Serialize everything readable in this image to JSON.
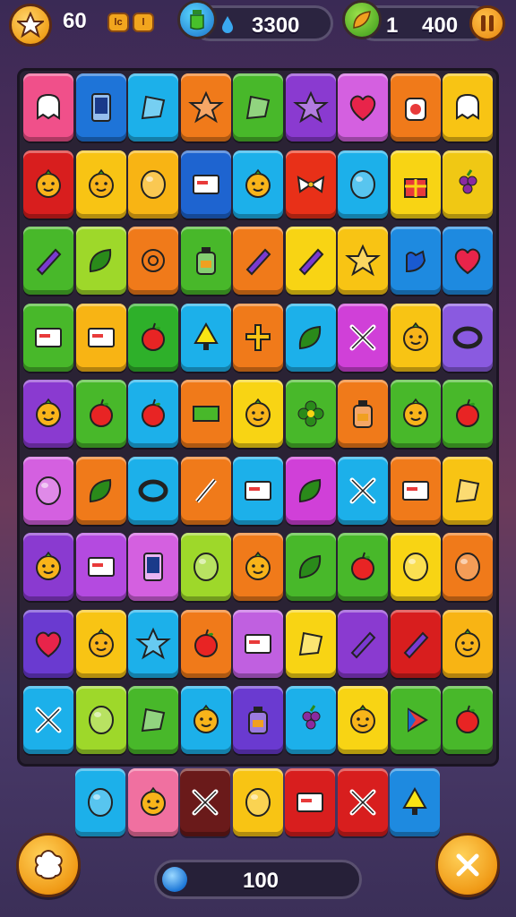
{
  "hud": {
    "score": "60",
    "badge_a": "lc",
    "badge_b": "l",
    "water_value": "3300",
    "leaf_level": "1",
    "leaf_value": "400"
  },
  "bottom": {
    "count": "100"
  },
  "board": {
    "rows": [
      [
        {
          "c": "#f0508a",
          "i": "ghost"
        },
        {
          "c": "#1e74d8",
          "i": "phone"
        },
        {
          "c": "#1cb0ea",
          "i": "flag"
        },
        {
          "c": "#f07a1a",
          "i": "star"
        },
        {
          "c": "#48b82a",
          "i": "flag"
        },
        {
          "c": "#8a3ad0",
          "i": "star"
        },
        {
          "c": "#d460e0",
          "i": "heart"
        },
        {
          "c": "#f07a1a",
          "i": "jar"
        },
        {
          "c": "#f8c414",
          "i": "ghost"
        }
      ],
      [
        {
          "c": "#d81e1e",
          "i": "face"
        },
        {
          "c": "#f8c414",
          "i": "face"
        },
        {
          "c": "#f8b414",
          "i": "orb"
        },
        {
          "c": "#1e64d0",
          "i": "card"
        },
        {
          "c": "#1cb0ea",
          "i": "face"
        },
        {
          "c": "#e83018",
          "i": "bow"
        },
        {
          "c": "#1cb0ea",
          "i": "orb"
        },
        {
          "c": "#f8d414",
          "i": "gift"
        },
        {
          "c": "#f0c814",
          "i": "grapes"
        }
      ],
      [
        {
          "c": "#48b82a",
          "i": "crayon"
        },
        {
          "c": "#9ed82a",
          "i": "leaf"
        },
        {
          "c": "#f07a1a",
          "i": "swirl"
        },
        {
          "c": "#48b82a",
          "i": "bottle"
        },
        {
          "c": "#f07a1a",
          "i": "crayon"
        },
        {
          "c": "#f8d414",
          "i": "crayon"
        },
        {
          "c": "#f8c414",
          "i": "star"
        },
        {
          "c": "#1e8ae0",
          "i": "hand"
        },
        {
          "c": "#1e8ae0",
          "i": "heart"
        }
      ],
      [
        {
          "c": "#48b82a",
          "i": "card"
        },
        {
          "c": "#f8b414",
          "i": "card"
        },
        {
          "c": "#2eb02a",
          "i": "apple"
        },
        {
          "c": "#1cb0ea",
          "i": "tree"
        },
        {
          "c": "#f07a1a",
          "i": "cross"
        },
        {
          "c": "#1cb0ea",
          "i": "leaf"
        },
        {
          "c": "#d040d8",
          "i": "x"
        },
        {
          "c": "#f8c414",
          "i": "face"
        },
        {
          "c": "#8a5ae0",
          "i": "ring"
        }
      ],
      [
        {
          "c": "#8a3ad0",
          "i": "face"
        },
        {
          "c": "#48b82a",
          "i": "apple"
        },
        {
          "c": "#1cb0ea",
          "i": "apple"
        },
        {
          "c": "#f07a1a",
          "i": "rect"
        },
        {
          "c": "#f8d414",
          "i": "face"
        },
        {
          "c": "#48b82a",
          "i": "flower"
        },
        {
          "c": "#f07a1a",
          "i": "bottle"
        },
        {
          "c": "#48b82a",
          "i": "face"
        },
        {
          "c": "#48b82a",
          "i": "apple"
        }
      ],
      [
        {
          "c": "#d460e0",
          "i": "orb"
        },
        {
          "c": "#f07a1a",
          "i": "leaf"
        },
        {
          "c": "#1cb0ea",
          "i": "ring"
        },
        {
          "c": "#f07a1a",
          "i": "brush"
        },
        {
          "c": "#1cb0ea",
          "i": "card"
        },
        {
          "c": "#d040d8",
          "i": "leaf"
        },
        {
          "c": "#1cb0ea",
          "i": "x"
        },
        {
          "c": "#f07a1a",
          "i": "card"
        },
        {
          "c": "#f8c414",
          "i": "flag"
        }
      ],
      [
        {
          "c": "#8a3ad0",
          "i": "face"
        },
        {
          "c": "#b44ae0",
          "i": "card"
        },
        {
          "c": "#d460e0",
          "i": "phone"
        },
        {
          "c": "#9ed82a",
          "i": "orb"
        },
        {
          "c": "#f07a1a",
          "i": "face"
        },
        {
          "c": "#48b82a",
          "i": "leaf"
        },
        {
          "c": "#48b82a",
          "i": "apple"
        },
        {
          "c": "#f8d414",
          "i": "orb"
        },
        {
          "c": "#f07a1a",
          "i": "orb"
        }
      ],
      [
        {
          "c": "#6a3ad0",
          "i": "heart"
        },
        {
          "c": "#f8c414",
          "i": "face"
        },
        {
          "c": "#1cb0ea",
          "i": "star"
        },
        {
          "c": "#f07a1a",
          "i": "apple"
        },
        {
          "c": "#c060e0",
          "i": "card"
        },
        {
          "c": "#f8d414",
          "i": "flag"
        },
        {
          "c": "#8a3ad0",
          "i": "crayon"
        },
        {
          "c": "#d81e1e",
          "i": "crayon"
        },
        {
          "c": "#f8b414",
          "i": "face"
        }
      ],
      [
        {
          "c": "#1cb0ea",
          "i": "x"
        },
        {
          "c": "#9ed82a",
          "i": "orb"
        },
        {
          "c": "#48b82a",
          "i": "flag"
        },
        {
          "c": "#1cb0ea",
          "i": "face"
        },
        {
          "c": "#6a3ad0",
          "i": "bottle"
        },
        {
          "c": "#1cb0ea",
          "i": "grapes"
        },
        {
          "c": "#f8d414",
          "i": "face"
        },
        {
          "c": "#48b82a",
          "i": "play"
        },
        {
          "c": "#48b82a",
          "i": "apple"
        }
      ]
    ],
    "extra": [
      {
        "c": "#1cb0ea",
        "i": "orb"
      },
      {
        "c": "#f070a0",
        "i": "face"
      },
      {
        "c": "#6a1a1a",
        "i": "x"
      },
      {
        "c": "#f8c414",
        "i": "orb"
      },
      {
        "c": "#d81e1e",
        "i": "card"
      },
      {
        "c": "#d81e1e",
        "i": "x"
      },
      {
        "c": "#1e8ae0",
        "i": "tree"
      }
    ]
  }
}
